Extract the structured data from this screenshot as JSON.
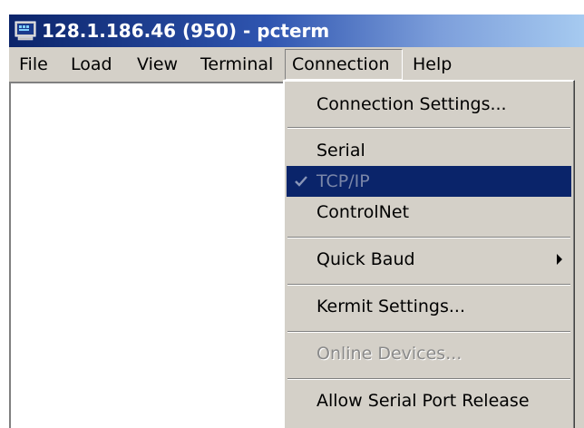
{
  "window": {
    "title": "128.1.186.46 (950) - pcterm",
    "icon": "terminal-app-icon"
  },
  "menubar": {
    "items": [
      {
        "label": "File"
      },
      {
        "label": "Load"
      },
      {
        "label": "View"
      },
      {
        "label": "Terminal"
      },
      {
        "label": "Connection"
      },
      {
        "label": "Help"
      }
    ]
  },
  "connection_menu": {
    "items": [
      {
        "label": "Connection Settings..."
      },
      {
        "label": "Serial"
      },
      {
        "label": "TCP/IP",
        "checked": true
      },
      {
        "label": "ControlNet"
      },
      {
        "label": "Quick Baud",
        "submenu": true
      },
      {
        "label": "Kermit Settings..."
      },
      {
        "label": "Online Devices...",
        "disabled": true
      },
      {
        "label": "Allow Serial Port Release"
      }
    ]
  },
  "colors": {
    "title_start": "#0b246a",
    "title_end": "#a6caf0",
    "highlight": "#0a246a",
    "face": "#d4d0c8"
  }
}
